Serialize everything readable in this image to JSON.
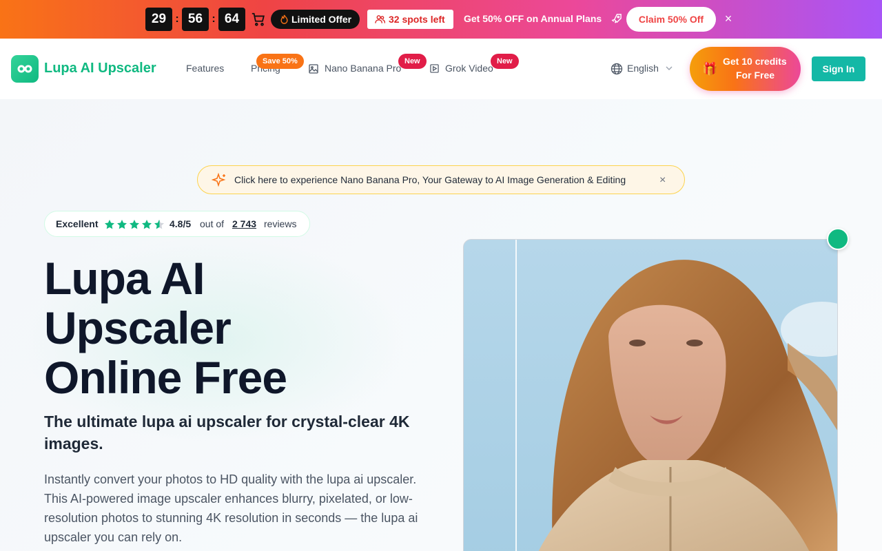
{
  "promo": {
    "timer": [
      "29",
      "56",
      "64"
    ],
    "separator": ":",
    "limited_offer": "Limited Offer",
    "spots_left": "32 spots left",
    "annual_text": "Get 50% OFF on Annual Plans",
    "claim_label": "Claim 50% Off",
    "close_symbol": "×"
  },
  "header": {
    "logo_text": "Lupa AI Upscaler",
    "nav": {
      "features": "Features",
      "pricing": "Pricing",
      "pricing_badge": "Save 50%",
      "nano": "Nano Banana Pro",
      "nano_badge": "New",
      "grok": "Grok Video",
      "grok_badge": "New"
    },
    "language": "English",
    "credits_line1": "Get 10 credits",
    "credits_line2": "For Free",
    "signin": "Sign In"
  },
  "hero": {
    "announcement": "Click here to experience Nano Banana Pro, Your Gateway to AI Image Generation & Editing",
    "announcement_close": "×",
    "rating": {
      "label": "Excellent",
      "score": "4.8/5",
      "out_of": "out of",
      "count": "2 743",
      "reviews": "reviews",
      "stars_value": 4.8,
      "stars_max": 5
    },
    "title_lines": [
      "Lupa AI",
      "Upscaler",
      "Online Free"
    ],
    "subtitle": "The ultimate lupa ai upscaler for crystal-clear 4K images.",
    "description": "Instantly convert your photos to HD quality with the lupa ai upscaler. This AI-powered image upscaler enhances blurry, pixelated, or low-resolution photos to stunning 4K resolution in seconds — the lupa ai upscaler you can rely on."
  },
  "colors": {
    "brand": "#10b981",
    "signin": "#14b8a6",
    "promo_start": "#f97316",
    "promo_end": "#a855f7",
    "badge_new": "#e11d48",
    "badge_save": "#f97316"
  },
  "icons": [
    "cart-icon",
    "fire-icon",
    "users-icon",
    "rocket-icon",
    "close-icon",
    "logo-icon",
    "image-icon",
    "video-icon",
    "globe-icon",
    "chevron-down-icon",
    "gift-icon",
    "sparkle-icon",
    "star-icon"
  ]
}
